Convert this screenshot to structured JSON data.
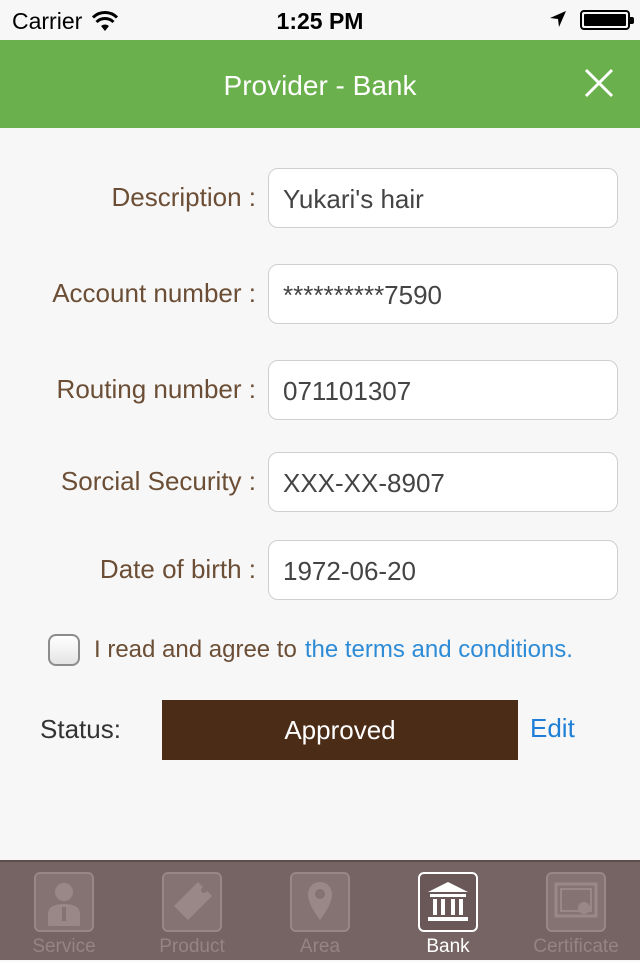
{
  "statusbar": {
    "carrier": "Carrier",
    "time": "1:25 PM"
  },
  "navbar": {
    "title": "Provider - Bank"
  },
  "form": {
    "description": {
      "label": "Description :",
      "value": "Yukari's hair"
    },
    "account": {
      "label": "Account number :",
      "value": "**********7590"
    },
    "routing": {
      "label": "Routing number :",
      "value": "071101307"
    },
    "ssn": {
      "label": "Sorcial Security :",
      "value": "XXX-XX-8907"
    },
    "dob": {
      "label": "Date of birth :",
      "value": "1972-06-20"
    }
  },
  "agree": {
    "text": "I read and agree to",
    "link": "the terms and conditions.",
    "checked": false
  },
  "status": {
    "label": "Status:",
    "value": "Approved",
    "edit": "Edit"
  },
  "tabs": [
    {
      "label": "Service",
      "icon": "person-icon",
      "active": false
    },
    {
      "label": "Product",
      "icon": "tag-icon",
      "active": false
    },
    {
      "label": "Area",
      "icon": "map-pin-icon",
      "active": false
    },
    {
      "label": "Bank",
      "icon": "bank-icon",
      "active": true
    },
    {
      "label": "Certificate",
      "icon": "certificate-icon",
      "active": false
    }
  ],
  "colors": {
    "navbar": "#6ab04c",
    "status_bg": "#4a2c17",
    "link": "#2e8bd6",
    "tabbar": "#766464"
  }
}
